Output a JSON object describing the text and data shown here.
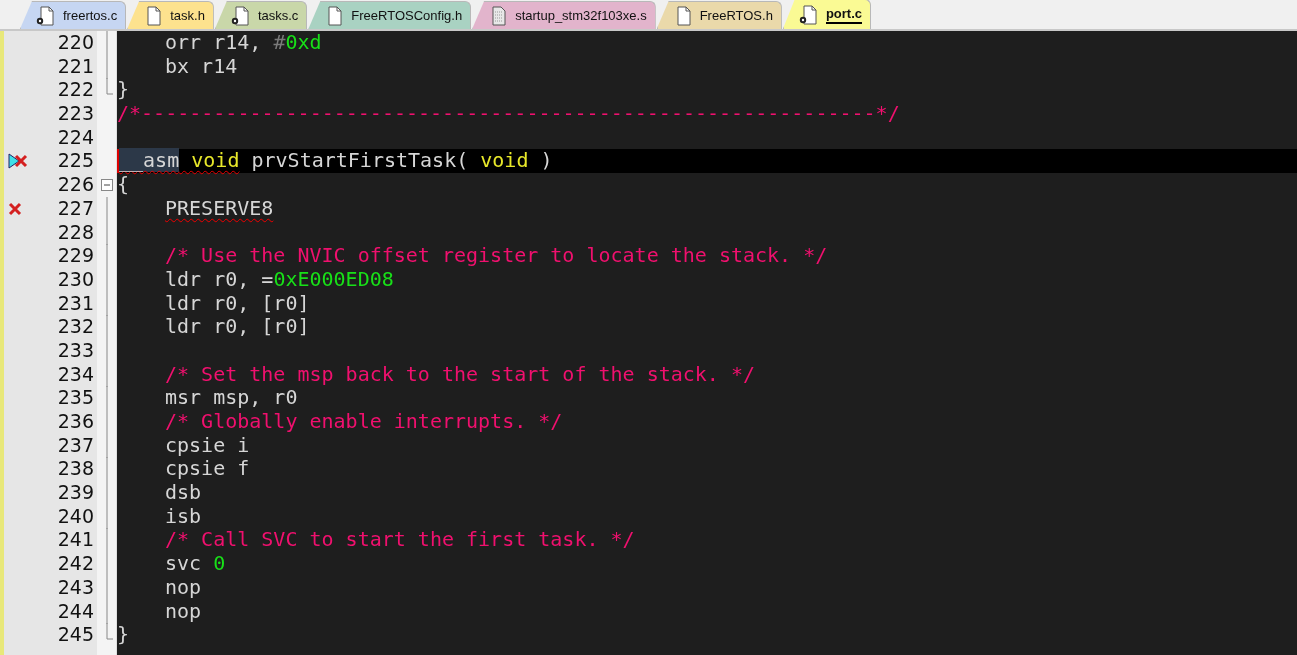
{
  "tabs": [
    {
      "label": "freertos.c",
      "kind": "source",
      "color": "#c6d6f2",
      "selected": false
    },
    {
      "label": "task.h",
      "kind": "header",
      "color": "#fde28e",
      "selected": false
    },
    {
      "label": "tasks.c",
      "kind": "source",
      "color": "#c9d7a9",
      "selected": false
    },
    {
      "label": "FreeRTOSConfig.h",
      "kind": "header",
      "color": "#a9d2c2",
      "selected": false
    },
    {
      "label": "startup_stm32f103xe.s",
      "kind": "asm",
      "color": "#e2b4cc",
      "selected": false
    },
    {
      "label": "FreeRTOS.h",
      "kind": "header",
      "color": "#ead9aa",
      "selected": false
    },
    {
      "label": "port.c",
      "kind": "source",
      "color": "#fafa94",
      "selected": true
    }
  ],
  "editor": {
    "lines": [
      {
        "number": "220",
        "fold": {
          "kind": "line"
        },
        "indented": true,
        "current": false,
        "segments": [
          {
            "kind": "code",
            "text": "orr r14, "
          },
          {
            "kind": "dim",
            "text": "#"
          },
          {
            "kind": "number",
            "text": "0xd"
          }
        ]
      },
      {
        "number": "221",
        "fold": {
          "kind": "line"
        },
        "indented": true,
        "current": false,
        "segments": [
          {
            "kind": "code",
            "text": "bx r14"
          }
        ]
      },
      {
        "number": "222",
        "fold": {
          "kind": "end"
        },
        "indented": false,
        "current": false,
        "segments": [
          {
            "kind": "code",
            "text": "}"
          }
        ]
      },
      {
        "number": "223",
        "indented": false,
        "current": false,
        "segments": [
          {
            "kind": "comment",
            "text": "/*-------------------------------------------------------------*/"
          }
        ]
      },
      {
        "number": "224",
        "current": false
      },
      {
        "number": "225",
        "marker": {
          "kind": "pointer-error"
        },
        "indented": false,
        "current": true,
        "segments": [
          {
            "kind": "marked",
            "text": "__asm",
            "squiggle": true
          },
          {
            "kind": "keyword",
            "text": " void",
            "squiggle": true
          },
          {
            "kind": "code",
            "text": " prvStartFirstTask( "
          },
          {
            "kind": "keyword",
            "text": "void"
          },
          {
            "kind": "code",
            "text": " )"
          }
        ]
      },
      {
        "number": "226",
        "fold": {
          "kind": "open"
        },
        "indented": false,
        "current": false,
        "segments": [
          {
            "kind": "code",
            "text": "{"
          }
        ]
      },
      {
        "number": "227",
        "marker": {
          "kind": "error"
        },
        "fold": {
          "kind": "line"
        },
        "indented": true,
        "current": false,
        "segments": [
          {
            "kind": "code",
            "text": "PRESERVE8",
            "squiggle": true
          }
        ]
      },
      {
        "number": "228",
        "fold": {
          "kind": "line"
        },
        "current": false
      },
      {
        "number": "229",
        "fold": {
          "kind": "line"
        },
        "indented": true,
        "current": false,
        "segments": [
          {
            "kind": "comment",
            "text": "/* Use the NVIC offset register to locate the stack. */"
          }
        ]
      },
      {
        "number": "230",
        "fold": {
          "kind": "line"
        },
        "indented": true,
        "current": false,
        "segments": [
          {
            "kind": "code",
            "text": "ldr r0, ="
          },
          {
            "kind": "number",
            "text": "0xE000ED08"
          }
        ]
      },
      {
        "number": "231",
        "fold": {
          "kind": "line"
        },
        "indented": true,
        "current": false,
        "segments": [
          {
            "kind": "code",
            "text": "ldr r0, [r0]"
          }
        ]
      },
      {
        "number": "232",
        "fold": {
          "kind": "line"
        },
        "indented": true,
        "current": false,
        "segments": [
          {
            "kind": "code",
            "text": "ldr r0, [r0]"
          }
        ]
      },
      {
        "number": "233",
        "fold": {
          "kind": "line"
        },
        "current": false
      },
      {
        "number": "234",
        "fold": {
          "kind": "line"
        },
        "indented": true,
        "current": false,
        "segments": [
          {
            "kind": "comment",
            "text": "/* Set the msp back to the start of the stack. */"
          }
        ]
      },
      {
        "number": "235",
        "fold": {
          "kind": "line"
        },
        "indented": true,
        "current": false,
        "segments": [
          {
            "kind": "code",
            "text": "msr msp, r0"
          }
        ]
      },
      {
        "number": "236",
        "fold": {
          "kind": "line"
        },
        "indented": true,
        "current": false,
        "segments": [
          {
            "kind": "comment",
            "text": "/* Globally enable interrupts. */"
          }
        ]
      },
      {
        "number": "237",
        "fold": {
          "kind": "line"
        },
        "indented": true,
        "current": false,
        "segments": [
          {
            "kind": "code",
            "text": "cpsie i"
          }
        ]
      },
      {
        "number": "238",
        "fold": {
          "kind": "line"
        },
        "indented": true,
        "current": false,
        "segments": [
          {
            "kind": "code",
            "text": "cpsie f"
          }
        ]
      },
      {
        "number": "239",
        "fold": {
          "kind": "line"
        },
        "indented": true,
        "current": false,
        "segments": [
          {
            "kind": "code",
            "text": "dsb"
          }
        ]
      },
      {
        "number": "240",
        "fold": {
          "kind": "line"
        },
        "indented": true,
        "current": false,
        "segments": [
          {
            "kind": "code",
            "text": "isb"
          }
        ]
      },
      {
        "number": "241",
        "fold": {
          "kind": "line"
        },
        "indented": true,
        "current": false,
        "segments": [
          {
            "kind": "comment",
            "text": "/* Call SVC to start the first task. */"
          }
        ]
      },
      {
        "number": "242",
        "fold": {
          "kind": "line"
        },
        "indented": true,
        "current": false,
        "segments": [
          {
            "kind": "code",
            "text": "svc "
          },
          {
            "kind": "number",
            "text": "0"
          }
        ]
      },
      {
        "number": "243",
        "fold": {
          "kind": "line"
        },
        "indented": true,
        "current": false,
        "segments": [
          {
            "kind": "code",
            "text": "nop"
          }
        ]
      },
      {
        "number": "244",
        "fold": {
          "kind": "line"
        },
        "indented": true,
        "current": false,
        "segments": [
          {
            "kind": "code",
            "text": "nop"
          }
        ]
      },
      {
        "number": "245",
        "fold": {
          "kind": "end"
        },
        "indented": false,
        "current": false,
        "segments": [
          {
            "kind": "code",
            "text": "}"
          }
        ]
      }
    ]
  }
}
